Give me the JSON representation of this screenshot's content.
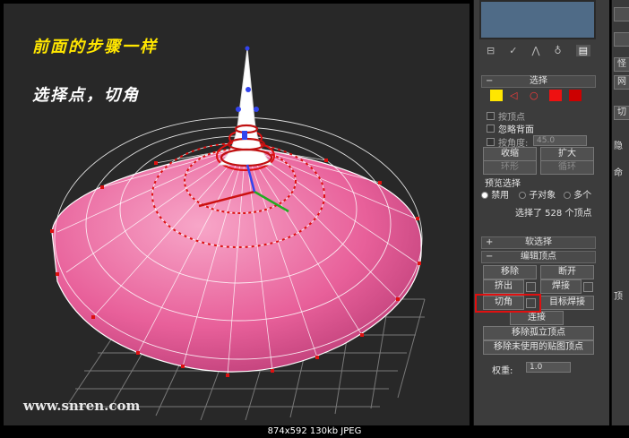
{
  "viewport": {
    "caption_line1": "前面的步骤一样",
    "caption_line2": "选择点，切角",
    "watermark": "www.snren.com"
  },
  "toolbar": {
    "tabs": [
      "⊟",
      "✓",
      "⋀",
      "♁",
      "▤"
    ]
  },
  "selection": {
    "title": "选择",
    "subobjects": [
      "vertex",
      "edge",
      "border",
      "polygon",
      "element"
    ],
    "by_vertex": "按顶点",
    "ignore_backfacing": "忽略背面",
    "by_angle": "按角度:",
    "angle_value": "45.0",
    "shrink": "收缩",
    "grow": "扩大",
    "ring": "环形",
    "loop": "循环",
    "preview_title": "预览选择",
    "preview_options": [
      "禁用",
      "子对象",
      "多个"
    ],
    "status": "选择了 528 个顶点"
  },
  "soft_selection": {
    "title": "软选择"
  },
  "edit_vertices": {
    "title": "编辑顶点",
    "remove": "移除",
    "break": "断开",
    "extrude": "挤出",
    "weld": "焊接",
    "chamfer": "切角",
    "target_weld": "目标焊接",
    "connect": "连接",
    "remove_isolated": "移除孤立顶点",
    "remove_unused_map": "移除未使用的贴图顶点",
    "weight_label": "权重:",
    "weight_value": "1.0"
  },
  "strip": {
    "items": [
      "怪",
      "网",
      "切",
      "隐",
      "命",
      "顶"
    ]
  },
  "statusbar": {
    "text": "874x592  130kb  JPEG"
  },
  "colors": {
    "mesh_pink": "#e8609a",
    "vertex_red": "#dd1111",
    "caption_yellow": "#ffe600",
    "highlight": "#e01010"
  }
}
